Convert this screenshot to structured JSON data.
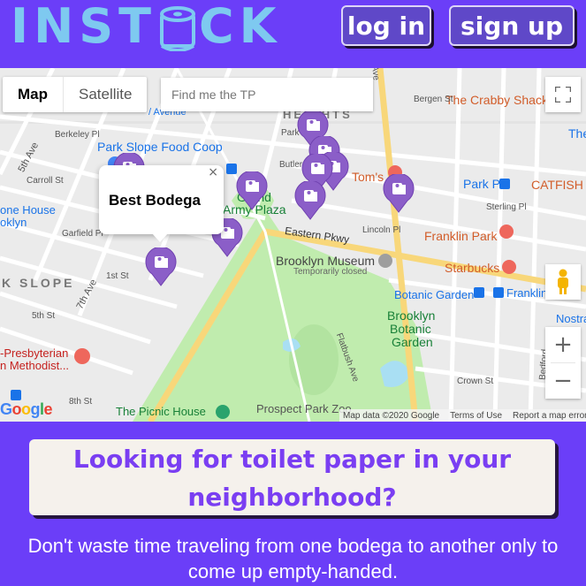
{
  "header": {
    "logo_text_left": "INST",
    "logo_text_right": "CK",
    "login_label": "log in",
    "signup_label": "sign up"
  },
  "map": {
    "maptype_map": "Map",
    "maptype_satellite": "Satellite",
    "search_placeholder": "Find me the TP",
    "infowindow_title": "Best Bodega",
    "infowindow_close": "×",
    "zoom_in": "+",
    "zoom_out": "−",
    "google_logo": "Google",
    "attribution": {
      "data": "Map data ©2020 Google",
      "terms": "Terms of Use",
      "report": "Report a map error"
    },
    "labels": {
      "park_slope_food_coop": "Park Slope Food Coop",
      "grand_army_plaza_1": "Grand",
      "grand_army_plaza_2": "Army Plaza",
      "eastern_pkwy": "Eastern Pkwy",
      "brooklyn_museum": "Brooklyn Museum",
      "temporarily_closed": "Temporarily closed",
      "crabby_shack": "The Crabby Shack",
      "toms": "Tom's",
      "park_pl": "Park Pl",
      "catfish": "CATFISH",
      "franklin_park": "Franklin Park",
      "starbucks": "Starbucks",
      "botanic_garden": "Botanic Garden",
      "franklin": "Franklin",
      "brooklyn_botanic_1": "Brooklyn",
      "brooklyn_botanic_2": "Botanic",
      "brooklyn_botanic_3": "Garden",
      "picnic_house": "The Picnic House",
      "prospect_park_zoo": "Prospect Park Zoo",
      "heights": "HEIGHTS",
      "park_slope": "K SLOPE",
      "one_house": "one House",
      "oklyn": "oklyn",
      "presbyterian": "-Presbyterian",
      "methodist": "n Methodist...",
      "nostra": "Nostra",
      "flatbush_ave": "Flatbush Ave",
      "washington_ave": "Washington Ave",
      "bergen_st": "Bergen St",
      "park_pl_st": "Park Pl",
      "sterling_pl": "Sterling Pl",
      "lincoln_pl": "Lincoln Pl",
      "crown_st": "Crown St",
      "avenue": "/ Avenue",
      "berkeley_pl": "Berkeley Pl",
      "carroll_st": "Carroll St",
      "garfield_pl": "Garfield Pl",
      "first_st": "1st St",
      "fifth_st": "5th St",
      "eighth_st": "8th St",
      "seventh_ave": "7th Ave",
      "fifth_ave": "5th Ave",
      "butler_pl": "Butler Pl",
      "the": "The",
      "bedford": "Bedford",
      "classon": "Ave"
    }
  },
  "hero": {
    "line1": "Looking for toilet paper in your",
    "line2": "neighborhood?"
  },
  "subtext": {
    "line1": "Don't waste time traveling from one bodega to another only to",
    "line2": "come up empty-handed."
  },
  "colors": {
    "brand_purple": "#6b3ef8",
    "logo_blue": "#7ec9f0",
    "marker_purple": "#8b5ec8",
    "park_green": "#c0ecae",
    "hero_text": "#7a3ef2"
  }
}
